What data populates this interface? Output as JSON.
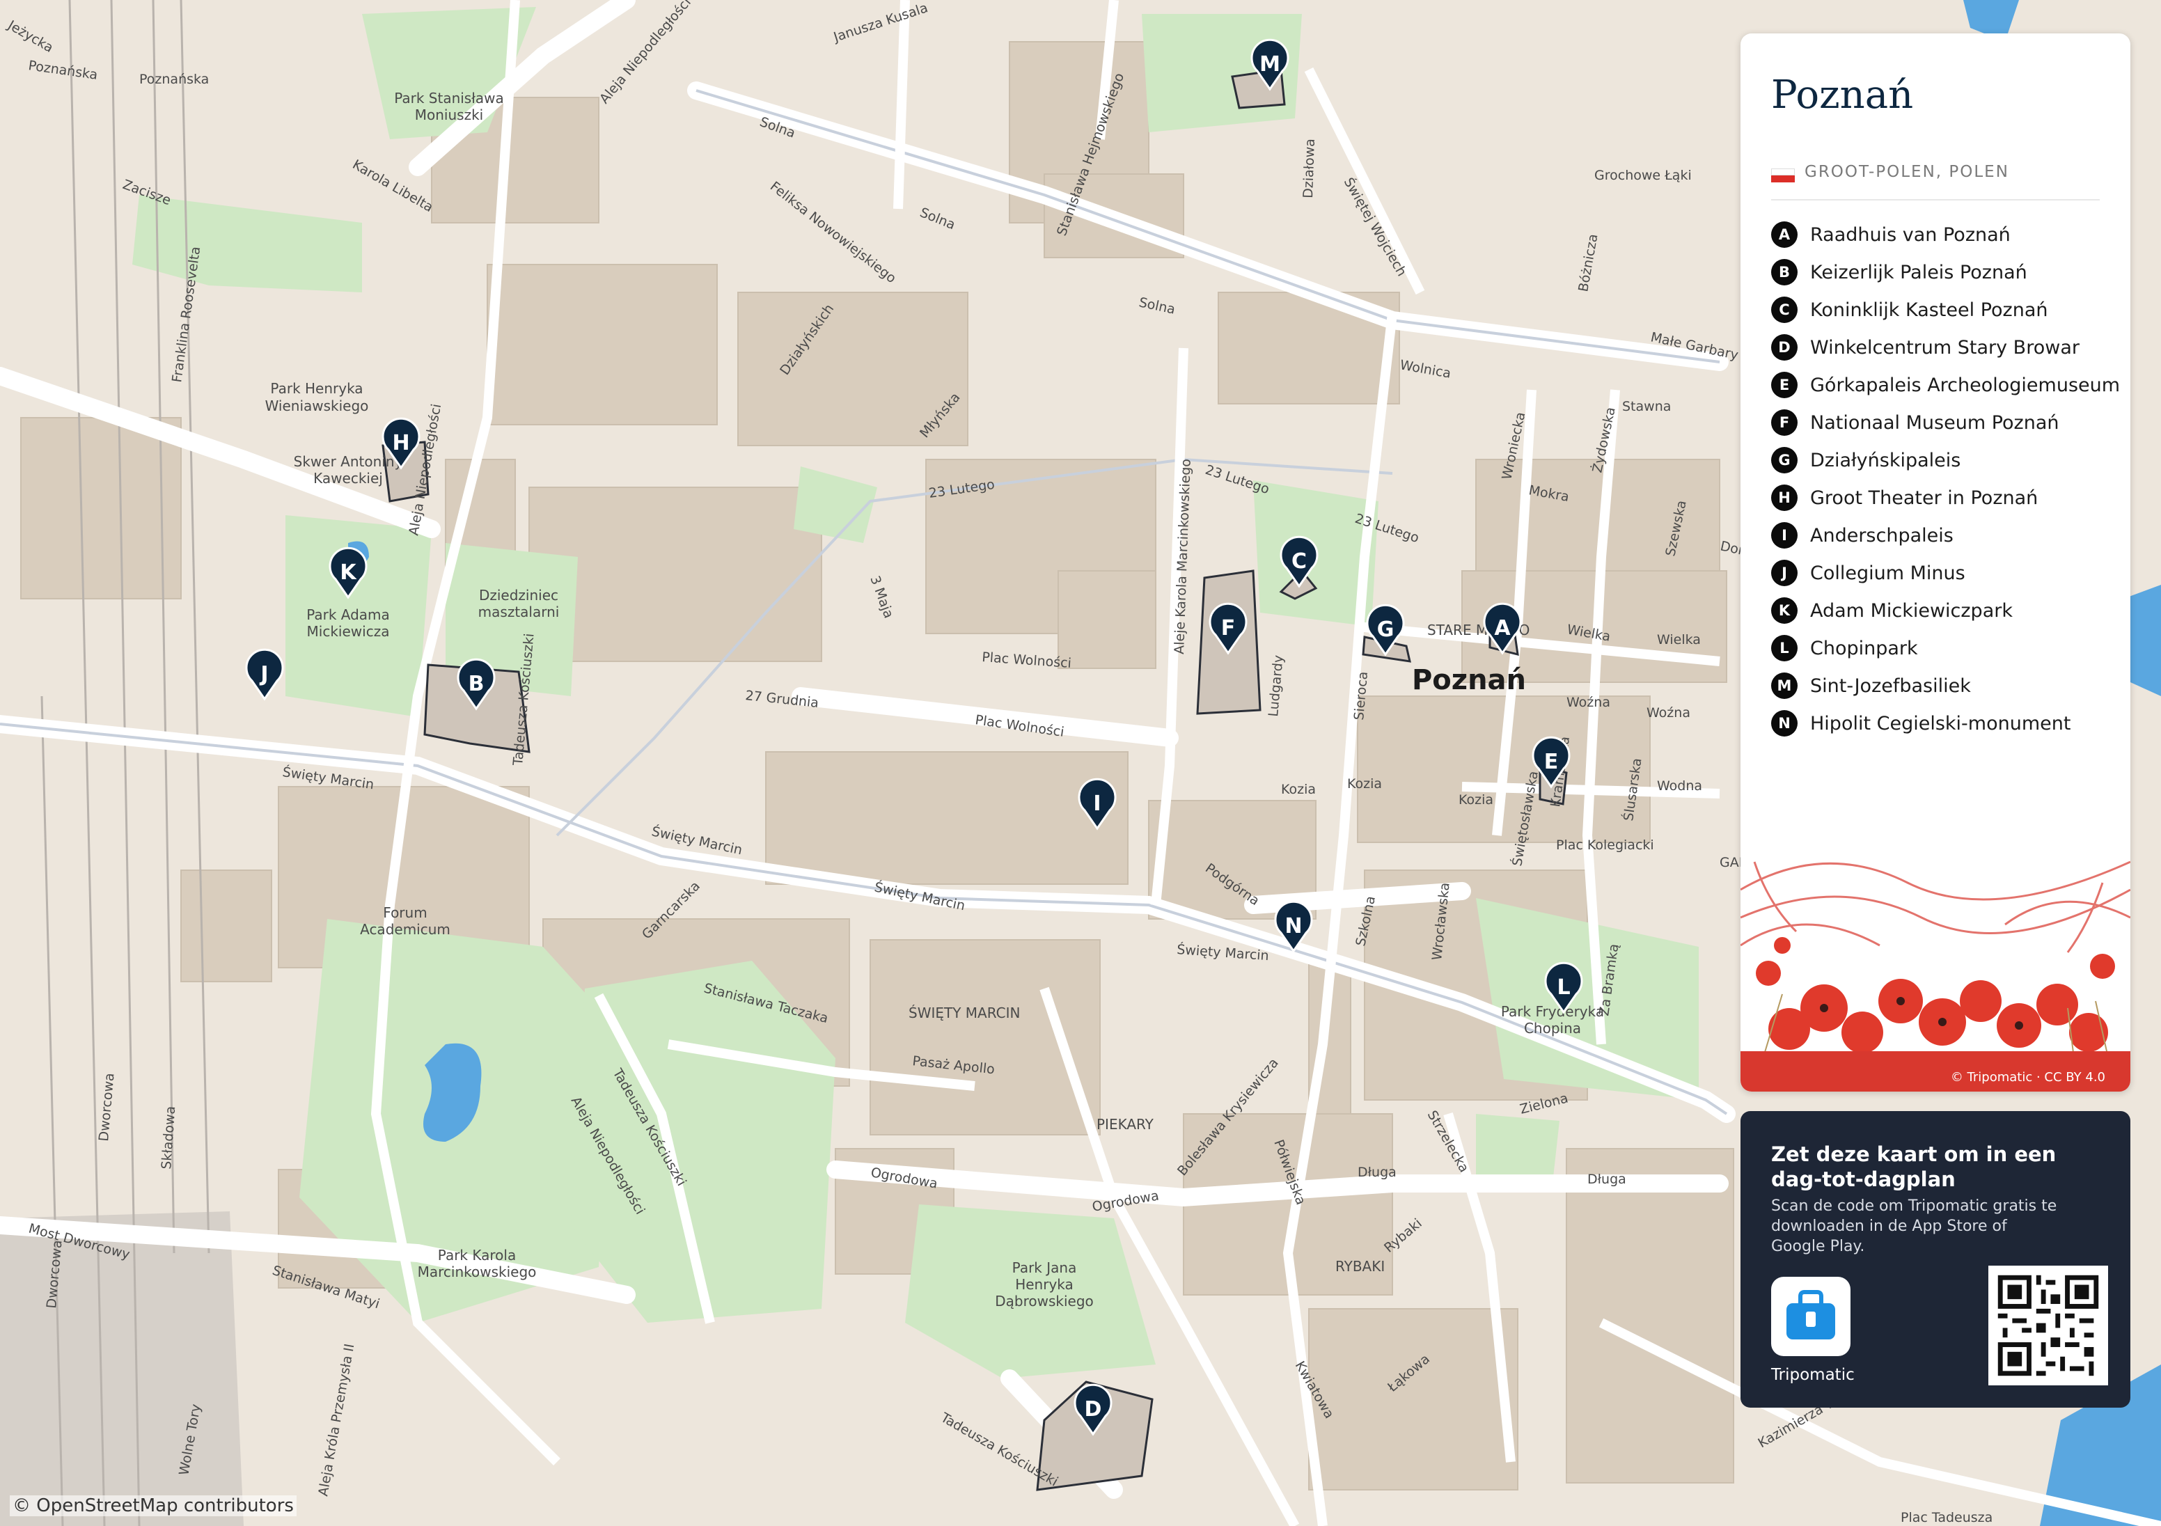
{
  "title": "Poznań",
  "region": "GROOT-POLEN, POLEN",
  "city_label": "Poznań",
  "legend": [
    {
      "letter": "A",
      "name": "Raadhuis van Poznań"
    },
    {
      "letter": "B",
      "name": "Keizerlijk Paleis Poznań"
    },
    {
      "letter": "C",
      "name": "Koninklijk Kasteel Poznań"
    },
    {
      "letter": "D",
      "name": "Winkelcentrum Stary Browar"
    },
    {
      "letter": "E",
      "name": "Górkapaleis Archeologiemuseum"
    },
    {
      "letter": "F",
      "name": "Nationaal Museum Poznań"
    },
    {
      "letter": "G",
      "name": "Działyńskipaleis"
    },
    {
      "letter": "H",
      "name": "Groot Theater in Poznań"
    },
    {
      "letter": "I",
      "name": "Anderschpaleis"
    },
    {
      "letter": "J",
      "name": "Collegium Minus"
    },
    {
      "letter": "K",
      "name": "Adam Mickiewiczpark"
    },
    {
      "letter": "L",
      "name": "Chopinpark"
    },
    {
      "letter": "M",
      "name": "Sint-Jozefbasiliek"
    },
    {
      "letter": "N",
      "name": "Hipolit Cegielski-monument"
    }
  ],
  "legend_credit": "© Tripomatic · CC BY 4.0",
  "promo": {
    "title": "Zet deze kaart om in een dag-tot-dagplan",
    "body": "Scan de code om Tripomatic gratis te downloaden in de App Store of Google Play.",
    "app_name": "Tripomatic"
  },
  "osm_credit": "© OpenStreetMap contributors",
  "colors": {
    "marker": "#0d2740",
    "panel_dark": "#1e2636",
    "flag_red": "#dc2e28",
    "park": "#cfe8c4",
    "water": "#5aa7e0",
    "building": "#d7cbbb"
  },
  "street_labels": [
    "Jeżycka",
    "Poznańska",
    "Zacisze",
    "Karola Libelta",
    "Aleja Niepodległości",
    "Janusza Kusala",
    "Solna",
    "Feliksa Nowowiejskiego",
    "Stanisława Hejmowskiego",
    "Działowa",
    "Świętej Wojciech",
    "Grochowe Łąki",
    "Bóżnicza",
    "Małe Garbary",
    "Wolnica",
    "Stawna",
    "Mokra",
    "Wroniecka",
    "Żydowska",
    "Szewska",
    "Dominikańska",
    "23 Lutego",
    "Aleje Karola Marcinkowskiego",
    "Ludgardy",
    "Sieroca",
    "Wielka",
    "Woźna",
    "Kozia",
    "Wodna",
    "Kramarska",
    "Ślusarska",
    "Świętosławska",
    "Plac Kolegiacki",
    "Garbary",
    "Za Bramką",
    "Wrocławska",
    "Szkolna",
    "Podgórna",
    "Plac Wolności",
    "27 Grudnia",
    "Święty Marcin",
    "Młyńska",
    "Działyńskich",
    "3 Maja",
    "Garncarska",
    "Stanisława Taczaka",
    "Pasaż Apollo",
    "Ogrodowa",
    "Dworcowa",
    "Składowa",
    "Most Dworcowy",
    "Stanisława Matyi",
    "Tadeusza Kościuszki",
    "Półwiejska",
    "Bolesława Krysiewicza",
    "Strzelecka",
    "Zielona",
    "Długa",
    "Rybaki",
    "Kwiatowa",
    "Łąkowa",
    "Kazimierza Wielkiego",
    "Plac Tadeusza",
    "Franklina Roosevelta",
    "Wolne Tory",
    "Aleja Króla Przemysła II"
  ],
  "area_labels": [
    "Park Stanisława Moniuszki",
    "Park Henryka Wieniawskiego",
    "Skwer Antoniny Kaweckiej",
    "Park Adama Mickiewicza",
    "Dziedziniec masztalarni",
    "Forum Academicum",
    "Park Karola Marcinkowskiego",
    "Park Jana Henryka Dąbrowskiego",
    "Park Fryderyka Chopina",
    "STARE MIASTO",
    "ŚWIĘTY MARCIN",
    "PIEKARY",
    "RYBAKI",
    "GARBARY"
  ]
}
